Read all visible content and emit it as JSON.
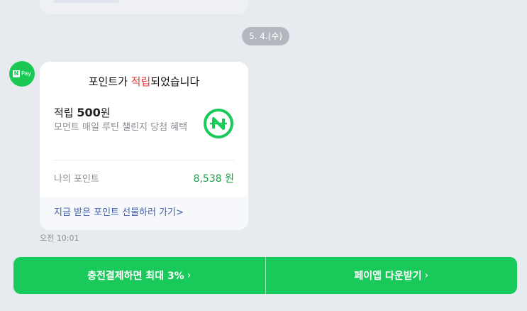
{
  "date_divider": "5. 4.(수)",
  "avatar": {
    "n_mark": "N",
    "label": "Pay"
  },
  "card": {
    "title_before": "포인트가 ",
    "title_highlight": "적립",
    "title_after": "되었습니다",
    "earn_prefix": "적립 ",
    "earn_amount": "500",
    "earn_unit": "원",
    "earn_desc": "모먼트 매일 루틴 챌린지 당첨 혜택",
    "points_label": "나의 포인트",
    "points_value": "8,538 원",
    "gift_link": "지금 받은 포인트 선물하러 가기>"
  },
  "message_time": "오전 10:01",
  "bottom": {
    "left_label": "충전결제하면 최대 3%",
    "right_label": "페이앱 다운받기",
    "chevron": "›"
  },
  "colors": {
    "brand_green": "#19c95a",
    "highlight_red": "#e23b3b",
    "link_blue": "#3f5fb0",
    "points_green": "#1aa04a"
  }
}
